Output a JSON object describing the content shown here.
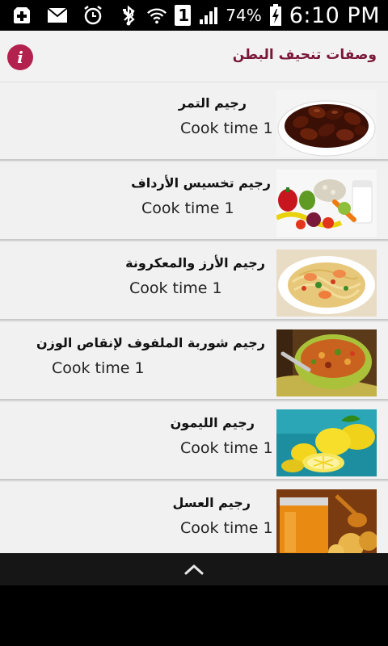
{
  "status_bar": {
    "battery": "74%",
    "time": "6:10 PM",
    "sim_slot": "1",
    "icons": [
      "hospital-plus-icon",
      "mail-icon",
      "alarm-icon",
      "usb-icon",
      "bluetooth-icon",
      "wifi-icon",
      "sim-icon",
      "signal-icon",
      "battery-charging-icon"
    ]
  },
  "header": {
    "title": "وصفات تنحيف البطن",
    "info_icon": "i"
  },
  "list": {
    "items": [
      {
        "title": "رجيم التمر",
        "subtitle": "Cook time 1",
        "image": "dates-bowl"
      },
      {
        "title": "رجيم تخسيس الأرداف",
        "subtitle": "Cook time 1",
        "image": "vegetables-milk"
      },
      {
        "title": "رجيم الأرز والمعكرونة",
        "subtitle": "Cook time 1",
        "image": "shrimp-pasta"
      },
      {
        "title": "رجيم شوربة الملفوف لإنقاص الوزن",
        "subtitle": "Cook time 1",
        "image": "cabbage-soup"
      },
      {
        "title": "رجيم الليمون",
        "subtitle": "Cook time 1",
        "image": "lemons"
      },
      {
        "title": "رجيم العسل",
        "subtitle": "Cook time 1",
        "image": "honey-jar"
      }
    ]
  },
  "colors": {
    "accent": "#b3224f",
    "title_text": "#7a1838",
    "row_bg": "#f1f1f1",
    "divider": "#c8c8c8"
  }
}
